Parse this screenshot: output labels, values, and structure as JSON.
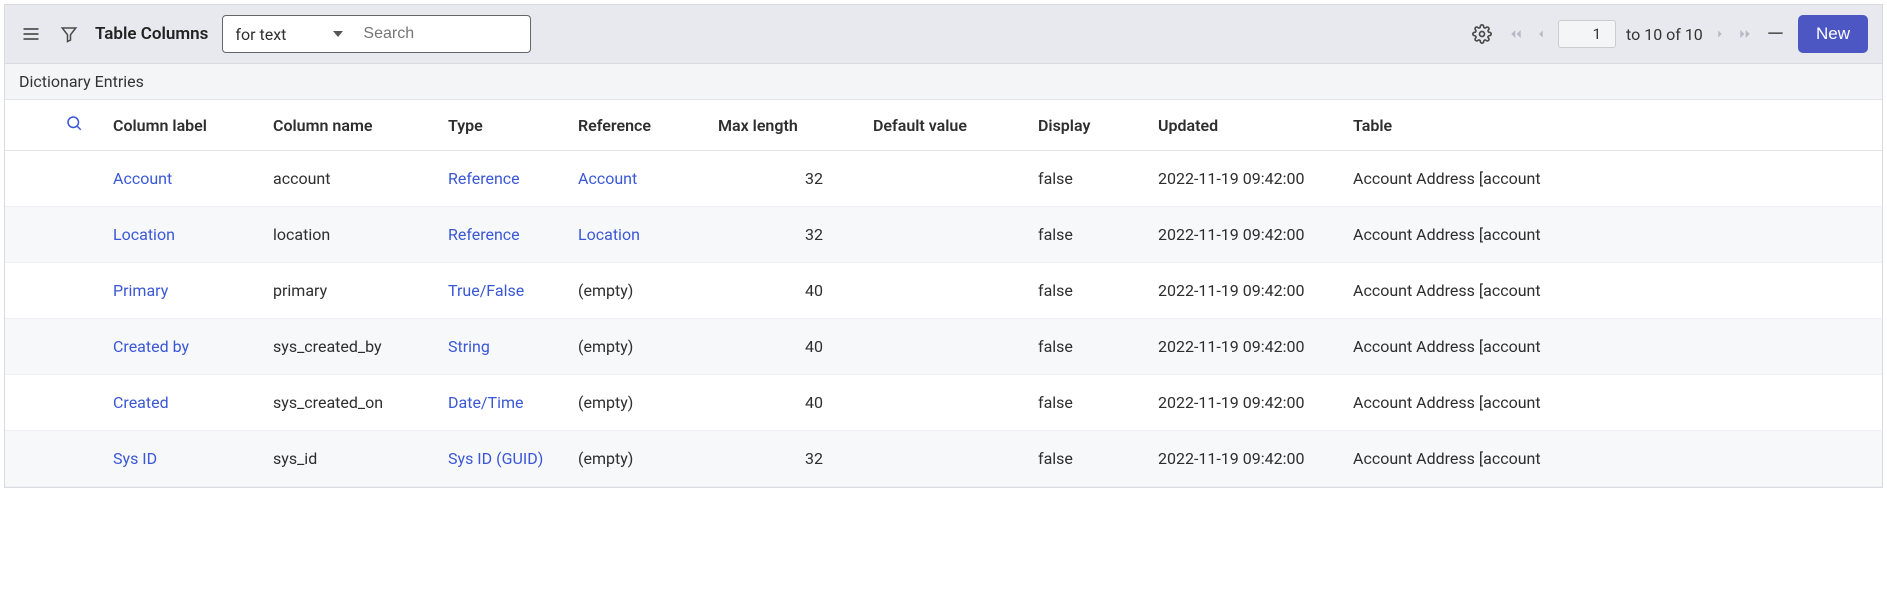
{
  "toolbar": {
    "title_label": "Table Columns",
    "search_mode": "for text",
    "search_placeholder": "Search",
    "new_label": "New"
  },
  "pager": {
    "current": "1",
    "range_label": "to 10 of 10"
  },
  "subheader": "Dictionary Entries",
  "columns": {
    "column_label": "Column label",
    "column_name": "Column name",
    "type": "Type",
    "reference": "Reference",
    "max_length": "Max length",
    "default_value": "Default value",
    "display": "Display",
    "updated": "Updated",
    "table": "Table"
  },
  "rows": [
    {
      "label": "Account",
      "name": "account",
      "type": "Reference",
      "reference": "Account",
      "max": "32",
      "default": "",
      "display": "false",
      "updated": "2022-11-19 09:42:00",
      "table": "Account Address [account"
    },
    {
      "label": "Location",
      "name": "location",
      "type": "Reference",
      "reference": "Location",
      "max": "32",
      "default": "",
      "display": "false",
      "updated": "2022-11-19 09:42:00",
      "table": "Account Address [account"
    },
    {
      "label": "Primary",
      "name": "primary",
      "type": "True/False",
      "reference": "(empty)",
      "max": "40",
      "default": "",
      "display": "false",
      "updated": "2022-11-19 09:42:00",
      "table": "Account Address [account"
    },
    {
      "label": "Created by",
      "name": "sys_created_by",
      "type": "String",
      "reference": "(empty)",
      "max": "40",
      "default": "",
      "display": "false",
      "updated": "2022-11-19 09:42:00",
      "table": "Account Address [account"
    },
    {
      "label": "Created",
      "name": "sys_created_on",
      "type": "Date/Time",
      "reference": "(empty)",
      "max": "40",
      "default": "",
      "display": "false",
      "updated": "2022-11-19 09:42:00",
      "table": "Account Address [account"
    },
    {
      "label": "Sys ID",
      "name": "sys_id",
      "type": "Sys ID (GUID)",
      "reference": "(empty)",
      "max": "32",
      "default": "",
      "display": "false",
      "updated": "2022-11-19 09:42:00",
      "table": "Account Address [account"
    }
  ]
}
